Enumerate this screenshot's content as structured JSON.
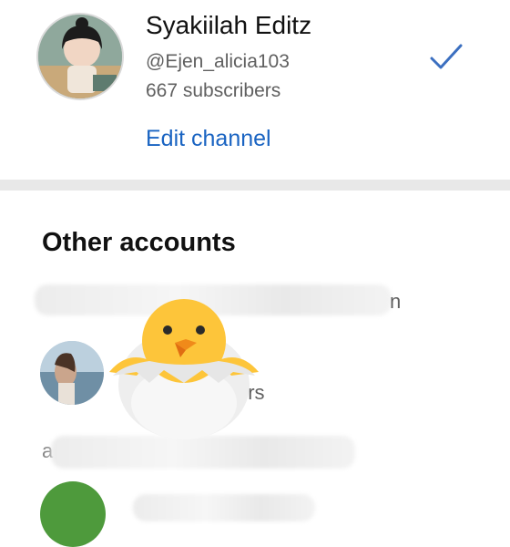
{
  "current_channel": {
    "name": "Syakiilah Editz",
    "handle": "@Ejen_alicia103",
    "subscribers": "667 subscribers",
    "edit_label": "Edit channel",
    "selected_icon": "checkmark-icon"
  },
  "other_accounts": {
    "title": "Other accounts",
    "items": [
      {
        "label_fragment": "n"
      },
      {
        "subscribers_fragment": "ers"
      },
      {
        "label_fragment": "a"
      }
    ]
  },
  "colors": {
    "link": "#1a64c2",
    "divider": "#e8e8e8",
    "check": "#3b6fc0",
    "avatar_green": "#4e9a3c"
  },
  "overlay": {
    "icon": "hatching-chick-icon"
  }
}
